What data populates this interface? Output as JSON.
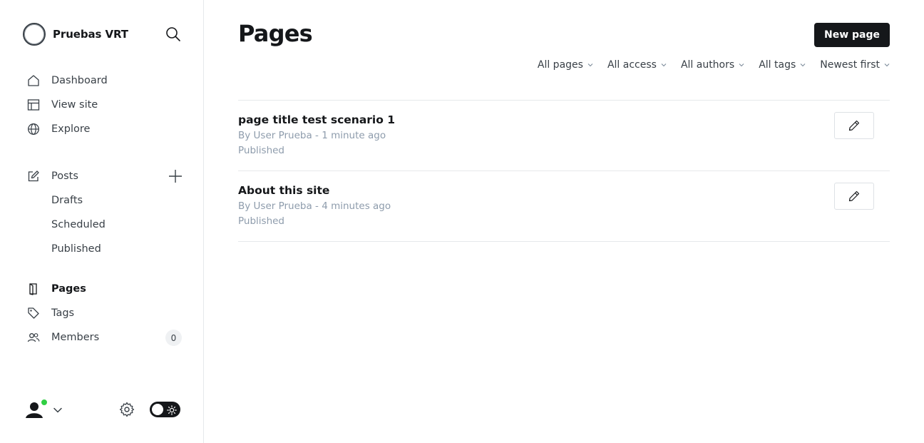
{
  "sidebar": {
    "site_name": "Pruebas VRT",
    "nav_primary": [
      {
        "label": "Dashboard",
        "icon": "home-icon"
      },
      {
        "label": "View site",
        "icon": "layout-icon"
      },
      {
        "label": "Explore",
        "icon": "globe-icon"
      }
    ],
    "posts": {
      "label": "Posts",
      "icon": "edit-icon",
      "sub_items": [
        {
          "label": "Drafts"
        },
        {
          "label": "Scheduled"
        },
        {
          "label": "Published"
        }
      ]
    },
    "nav_secondary": [
      {
        "label": "Pages",
        "icon": "page-icon",
        "active": true
      },
      {
        "label": "Tags",
        "icon": "tag-icon"
      },
      {
        "label": "Members",
        "icon": "members-icon",
        "badge": "0"
      }
    ]
  },
  "header": {
    "title": "Pages",
    "new_button_label": "New page"
  },
  "filters": [
    {
      "label": "All pages"
    },
    {
      "label": "All access"
    },
    {
      "label": "All authors"
    },
    {
      "label": "All tags"
    },
    {
      "label": "Newest first"
    }
  ],
  "pages": [
    {
      "title": "page title test scenario 1",
      "meta": "By User Prueba - 1 minute ago",
      "status": "Published"
    },
    {
      "title": "About this site",
      "meta": "By User Prueba - 4 minutes ago",
      "status": "Published"
    }
  ],
  "colors": {
    "accent_dark": "#15171a",
    "online": "#30cf43",
    "muted_text": "#8e9cac"
  }
}
